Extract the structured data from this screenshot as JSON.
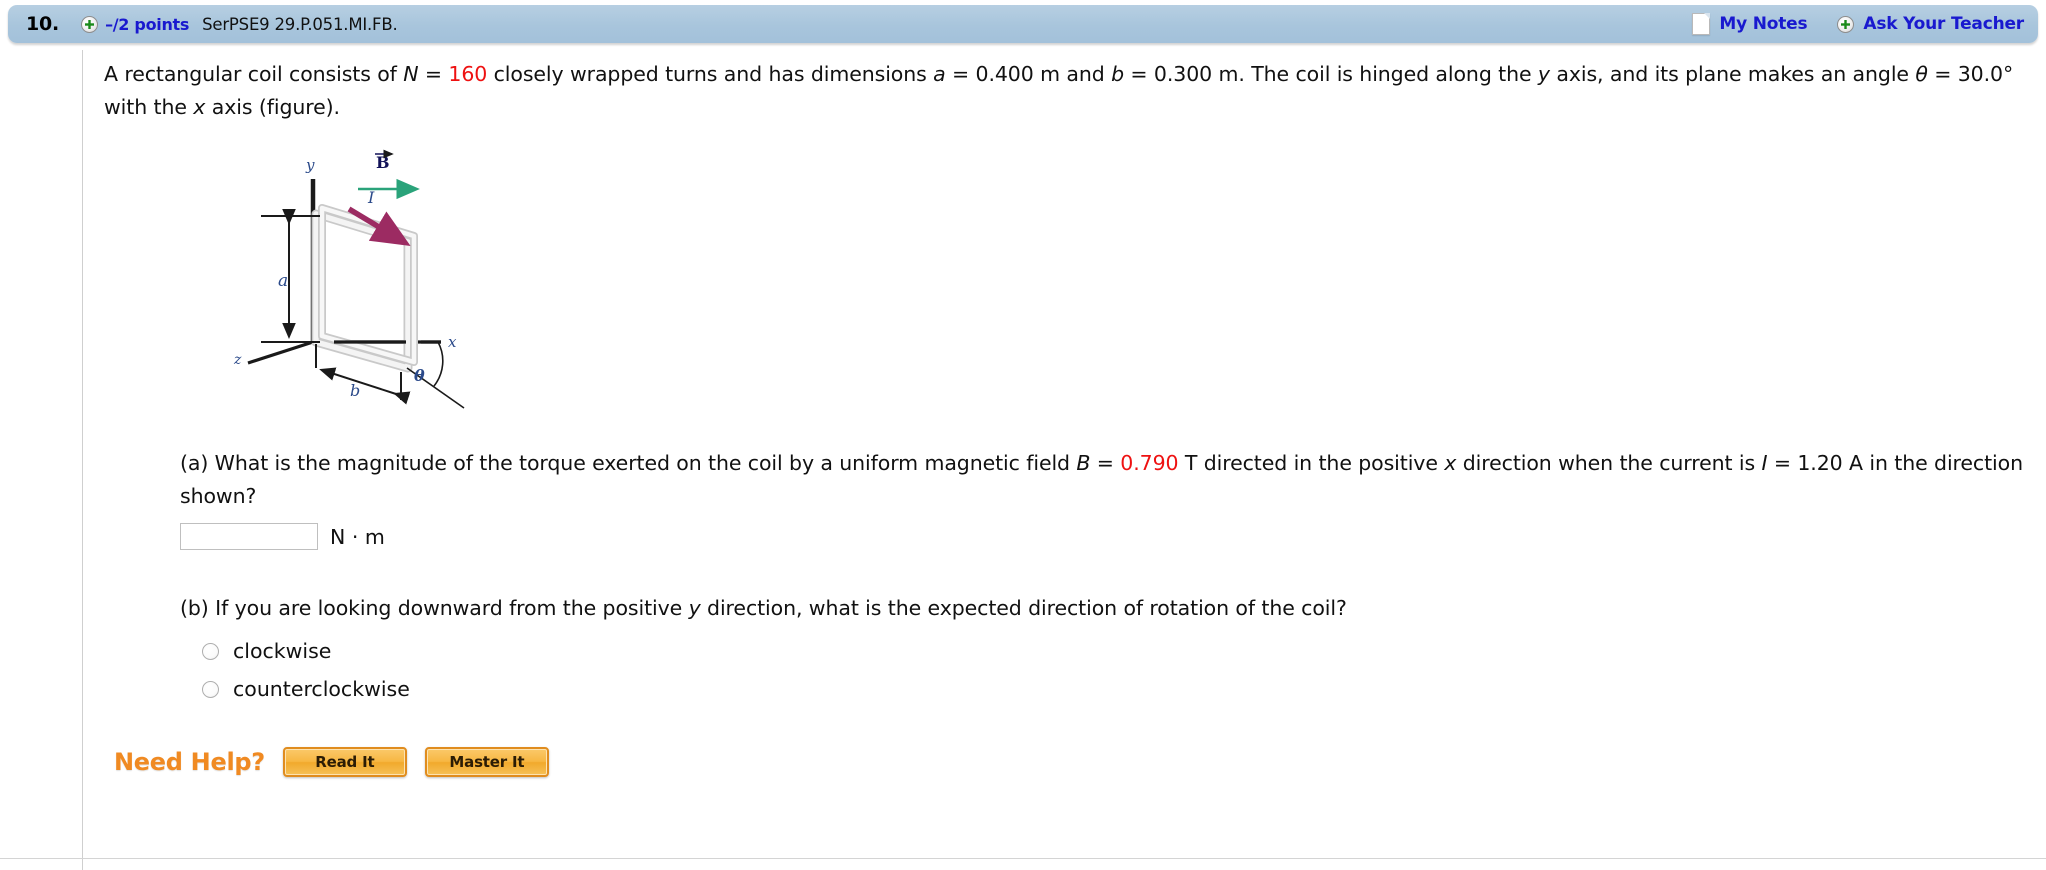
{
  "header": {
    "question_number": "10.",
    "plus_icon": "plus-circle-icon",
    "points": "–/2 points",
    "question_code": "SerPSE9 29.P.051.MI.FB.",
    "my_notes_label": "My Notes",
    "note_icon": "note-page-icon",
    "ask_teacher_label": "Ask Your Teacher",
    "ask_plus_icon": "plus-circle-icon",
    "bar_color": "#a8c5dc",
    "link_color": "#1919cf"
  },
  "problem": {
    "line1_a": "A rectangular coil consists of ",
    "var_N": "N",
    "eq1": " = ",
    "val_N": "160",
    "line1_b": " closely wrapped turns and has dimensions ",
    "var_a": "a",
    "val_a": " = 0.400 m",
    "line1_c": " and ",
    "var_b": "b",
    "val_b": " = 0.300 m.",
    "line1_d": " The coil is hinged along the ",
    "axis_y": "y",
    "line1_e": " axis, and its plane makes an angle ",
    "var_theta": "θ",
    "val_theta": " = 30.0°",
    "line1_f": " with the ",
    "axis_x": "x",
    "line1_g": " axis (figure)."
  },
  "figure": {
    "label_y": "y",
    "label_x": "x",
    "label_z": "z",
    "label_a": "a",
    "label_b": "b",
    "label_theta": "θ",
    "label_B": "B",
    "label_I": "I",
    "b_arrow_color": "#2aa37a",
    "i_arrow_color": "#9c2b62",
    "coil_color": "#d8d8d8"
  },
  "part_a": {
    "prefix": "(a) What is the magnitude of the torque exerted on the coil by a uniform magnetic field ",
    "var_B": "B",
    "eq": " = ",
    "val_B": "0.790",
    "unit_B": " T",
    "mid": " directed in the positive ",
    "axis_x": "x",
    "mid2": " direction when the current is ",
    "var_I": "I",
    "val_I": " = 1.20 A",
    "suffix": " in the direction shown?",
    "answer_value": "",
    "answer_placeholder": "",
    "answer_units": "N · m"
  },
  "part_b": {
    "prompt_1": "(b) If you are looking downward from the positive ",
    "axis_y": "y",
    "prompt_2": " direction, what is the expected direction of rotation of the coil?",
    "options": [
      {
        "label": "clockwise",
        "selected": false
      },
      {
        "label": "counterclockwise",
        "selected": false
      }
    ]
  },
  "need_help": {
    "label": "Need Help?",
    "label_color": "#f08a22",
    "buttons": [
      {
        "label": "Read It"
      },
      {
        "label": "Master It"
      }
    ]
  }
}
